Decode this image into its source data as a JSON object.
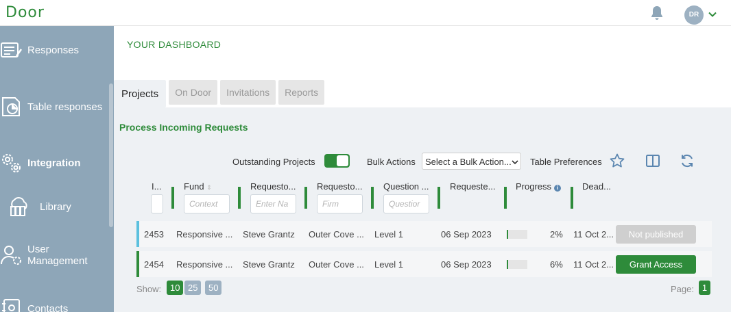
{
  "app": {
    "logo": "Door"
  },
  "header": {
    "avatar_initials": "DR"
  },
  "sidebar": {
    "items": [
      {
        "label": "Responses",
        "icon": "responses-icon"
      },
      {
        "label": "Table responses",
        "icon": "table-responses-icon"
      },
      {
        "label": "Integration",
        "icon": "integration-icon"
      },
      {
        "label": "Library",
        "icon": "library-icon"
      },
      {
        "label": "User Management",
        "icon": "user-management-icon"
      },
      {
        "label": "Contacts",
        "icon": "contacts-icon"
      }
    ]
  },
  "main": {
    "dashboard_title": "YOUR DASHBOARD",
    "tabs": [
      {
        "label": "Projects",
        "active": true
      },
      {
        "label": "On Door",
        "active": false
      },
      {
        "label": "Invitations",
        "active": false
      },
      {
        "label": "Reports",
        "active": false
      }
    ],
    "section_title": "Process Incoming Requests",
    "toolbar": {
      "outstanding_label": "Outstanding Projects",
      "outstanding_on": true,
      "bulk_label": "Bulk Actions",
      "bulk_select_value": "Select a Bulk Action...",
      "table_prefs_label": "Table Preferences"
    },
    "columns": [
      {
        "label": "I...",
        "filter_placeholder": ""
      },
      {
        "label": "Fund",
        "filter_placeholder": "Context"
      },
      {
        "label": "Requesto...",
        "filter_placeholder": "Enter Na"
      },
      {
        "label": "Requesto...",
        "filter_placeholder": "Firm"
      },
      {
        "label": "Question ...",
        "filter_placeholder": "Questior"
      },
      {
        "label": "Requeste...",
        "filter_placeholder": ""
      },
      {
        "label": "Progress",
        "filter_placeholder": ""
      },
      {
        "label": "Dead...",
        "filter_placeholder": ""
      }
    ],
    "rows": [
      {
        "id": "2453",
        "fund": "Responsive ...",
        "requestor_name": "Steve Grantz",
        "requestor_firm": "Outer Cove ...",
        "question": "Level 1",
        "requested": "06 Sep 2023",
        "progress": 2,
        "progress_label": "2%",
        "deadline": "11 Oct 2...",
        "action": "Not published",
        "action_enabled": false,
        "marker_color": "#5bc0de"
      },
      {
        "id": "2454",
        "fund": "Responsive ...",
        "requestor_name": "Steve Grantz",
        "requestor_firm": "Outer Cove ...",
        "question": "Level 1",
        "requested": "06 Sep 2023",
        "progress": 6,
        "progress_label": "6%",
        "deadline": "11 Oct 2...",
        "action": "Grant Access",
        "action_enabled": true,
        "marker_color": "#2e8b3a"
      }
    ],
    "footer": {
      "show_label": "Show:",
      "page_sizes": [
        "10",
        "25",
        "50"
      ],
      "selected_page_size": "10",
      "page_label": "Page:",
      "current_page": "1"
    }
  },
  "colors": {
    "brand_green": "#2e8b3a",
    "sidebar": "#8ea6b8",
    "disabled_button": "#cfcfcf",
    "page_size_inactive": "#9db1c2"
  }
}
